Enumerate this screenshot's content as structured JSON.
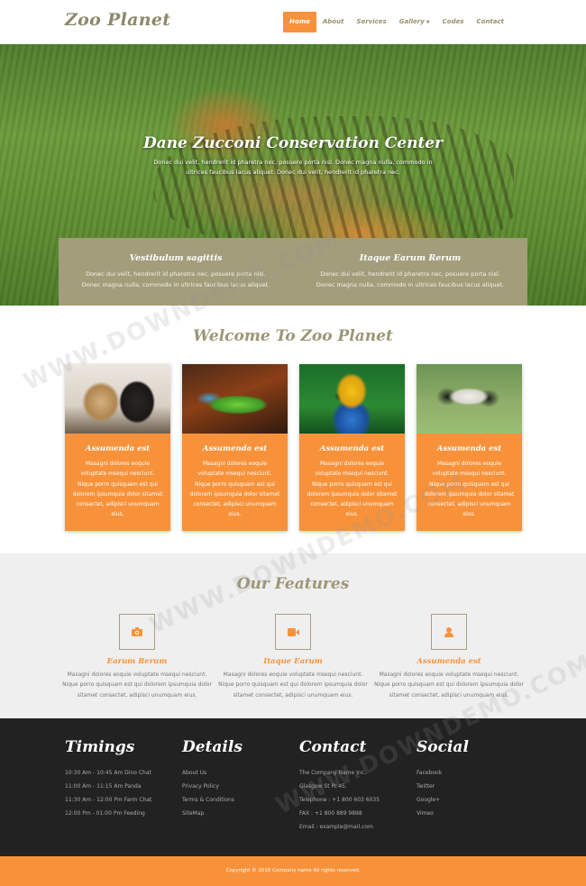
{
  "header": {
    "logo": "Zoo Planet",
    "nav": [
      {
        "label": "Home"
      },
      {
        "label": "About"
      },
      {
        "label": "Services"
      },
      {
        "label": "Gallery"
      },
      {
        "label": "Codes"
      },
      {
        "label": "Contact"
      }
    ]
  },
  "hero": {
    "title": "Dane Zucconi Conservation Center",
    "text": "Donec dui velit, hendrerit id pharetra nec, posuere porta nisl. Donec magna nulla, commodo in ultrices faucibus lacus aliquet. Donec dui velit, hendrerit id pharetra nec.",
    "box": {
      "left": {
        "title": "Vestibulum sagittis",
        "text": "Donec dui velit, hendrerit id pharetra nec, posuere porta nisl. Donec magna nulla, commodo in ultrices faucibus lacus aliquet."
      },
      "right": {
        "title": "Itaque Earum Rerum",
        "text": "Donec dui velit, hendrerit id pharetra nec, posuere porta nisl. Donec magna nulla, commodo in ultrices faucibus lacus aliquet."
      }
    }
  },
  "welcome": {
    "title": "Welcome To Zoo Planet",
    "cards": [
      {
        "title": "Assumenda est",
        "text": "Masagni dolores eoquie voluptate msequi nesciunt. Nique porro quisquam est qui dolorem ipsumquia dolor sitamet consectet, adipisci unumquam eius."
      },
      {
        "title": "Assumenda est",
        "text": "Masagni dolores eoquie voluptate msequi nesciunt. Nique porro quisquam est qui dolorem ipsumquia dolor sitamet consectet, adipisci unumquam eius."
      },
      {
        "title": "Assumenda est",
        "text": "Masagni dolores eoquie voluptate msequi nesciunt. Nique porro quisquam est qui dolorem ipsumquia dolor sitamet consectet, adipisci unumquam eius."
      },
      {
        "title": "Assumenda est",
        "text": "Masagni dolores eoquie voluptate msequi nesciunt. Nique porro quisquam est qui dolorem ipsumquia dolor sitamet consectet, adipisci unumquam eius."
      }
    ]
  },
  "features": {
    "title": "Our Features",
    "items": [
      {
        "title": "Earum Rerum",
        "icon": "camera-icon",
        "text": "Masagni dolores eoquie voluptate msequi nesciunt. Nique porro quisquam est qui dolorem ipsumquia dolor sitamet consectet, adipisci unumquam eius."
      },
      {
        "title": "Itaque Earum",
        "icon": "video-camera-icon",
        "text": "Masagni dolores eoquie voluptate msequi nesciunt. Nique porro quisquam est qui dolorem ipsumquia dolor sitamet consectet, adipisci unumquam eius."
      },
      {
        "title": "Assumenda est",
        "icon": "user-icon",
        "text": "Masagni dolores eoquie voluptate msequi nesciunt. Nique porro quisquam est qui dolorem ipsumquia dolor sitamet consectet, adipisci unumquam eius."
      }
    ]
  },
  "footer": {
    "timings": {
      "title": "Timings",
      "items": [
        "10:30 Am - 10:45 Am Dino Chat",
        "11:00 Am - 11:15 Am Panda",
        "11:30 Am - 12:00 Pm Farm Chat",
        "12:00 Pm - 01:00 Pm Feeding"
      ]
    },
    "details": {
      "title": "Details",
      "items": [
        "About Us",
        "Privacy Policy",
        "Terms & Conditions",
        "SiteMap"
      ]
    },
    "contact": {
      "title": "Contact",
      "items": [
        "The Company Name Inc.",
        "Glasgow St Pr 45.",
        "Telephone : +1 800 603 6035",
        "FAX : +1 800 889 9898",
        "Email : example@mail.com"
      ]
    },
    "social": {
      "title": "Social",
      "items": [
        "Facebook",
        "Twitter",
        "Google+",
        "Vimeo"
      ]
    }
  },
  "copyright": "Copyright © 2016 Company name All rights reserved.",
  "watermark": "WWW.DOWNDEMO.COM",
  "colors": {
    "accent": "#f7923a",
    "olive": "#a39d7c",
    "footer": "#222222",
    "title": "#9c9677"
  }
}
